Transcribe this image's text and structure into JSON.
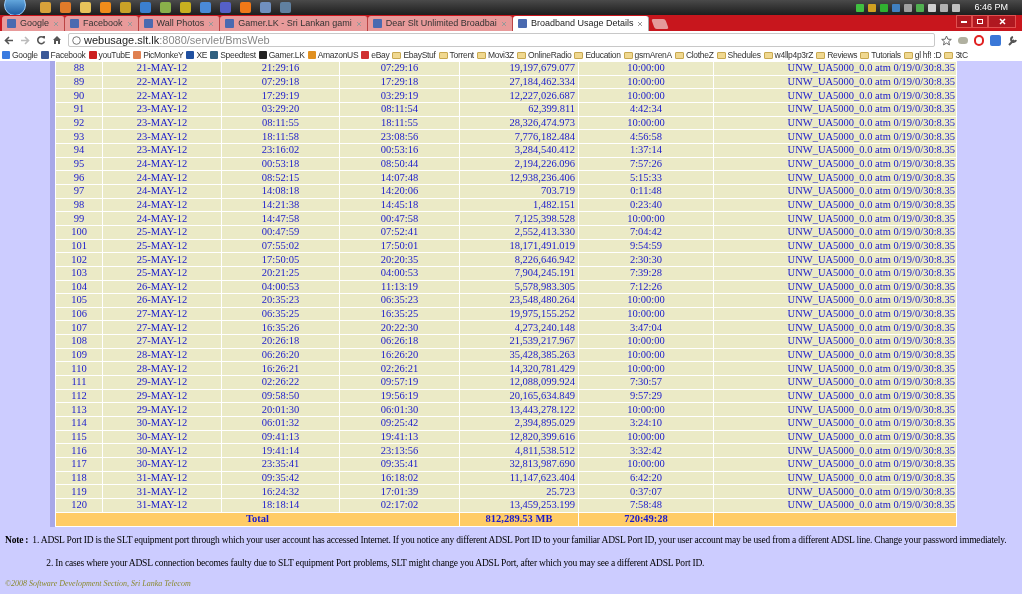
{
  "taskbar": {
    "apps": [
      {
        "color": "#d9a23a"
      },
      {
        "color": "#e07b2a"
      },
      {
        "color": "#e8c35a"
      },
      {
        "color": "#f08c1a"
      },
      {
        "color": "#c9a227"
      },
      {
        "color": "#3b7fd0"
      },
      {
        "color": "#8ab04a"
      },
      {
        "color": "#c8b020"
      },
      {
        "color": "#4a8ad8"
      },
      {
        "color": "#5560c8"
      },
      {
        "color": "#f07818"
      },
      {
        "color": "#7090c0"
      },
      {
        "color": "#6080a0"
      }
    ],
    "tray": [
      {
        "color": "#40c040"
      },
      {
        "color": "#d0a020"
      },
      {
        "color": "#30b030"
      },
      {
        "color": "#4080c0"
      },
      {
        "color": "#a0a0a0"
      },
      {
        "color": "#50b050"
      },
      {
        "color": "#d0d0d0"
      },
      {
        "color": "#b0b0b0"
      },
      {
        "color": "#c0c0c0"
      }
    ],
    "clock": "6:46 PM"
  },
  "tabs": [
    {
      "label": "Google",
      "selected": false
    },
    {
      "label": "Facebook",
      "selected": false
    },
    {
      "label": "Wall Photos",
      "selected": false
    },
    {
      "label": "Gamer.LK - Sri Lankan gami",
      "selected": false
    },
    {
      "label": "Dear Slt Unlimited Broadbai",
      "selected": false
    },
    {
      "label": "Broadband Usage Details",
      "selected": true
    }
  ],
  "address": {
    "host": "webusage.slt.lk",
    "path": ":8080/servlet/BmsWeb"
  },
  "bookmarks": [
    {
      "label": "Google",
      "kind": "site",
      "color": "#3a7be0"
    },
    {
      "label": "Facebook",
      "kind": "site",
      "color": "#3b5998"
    },
    {
      "label": "youTubE",
      "kind": "site",
      "color": "#cc2020"
    },
    {
      "label": "PicMonkeY",
      "kind": "site",
      "color": "#e08050"
    },
    {
      "label": "XE",
      "kind": "site",
      "color": "#2050a0"
    },
    {
      "label": "Speedtest",
      "kind": "site",
      "color": "#306080"
    },
    {
      "label": "Gamer.LK",
      "kind": "site",
      "color": "#222222"
    },
    {
      "label": "AmazonUS",
      "kind": "site",
      "color": "#e09020"
    },
    {
      "label": "eBay",
      "kind": "site",
      "color": "#d03030"
    },
    {
      "label": "EbayStuf",
      "kind": "folder"
    },
    {
      "label": "Torrent",
      "kind": "folder"
    },
    {
      "label": "Movi3Z",
      "kind": "folder"
    },
    {
      "label": "OnlineRadio",
      "kind": "folder"
    },
    {
      "label": "Education",
      "kind": "folder"
    },
    {
      "label": "gsmArenA",
      "kind": "folder"
    },
    {
      "label": "ClotheZ",
      "kind": "folder"
    },
    {
      "label": "Shedules",
      "kind": "folder"
    },
    {
      "label": "w4llp4p3rZ",
      "kind": "folder"
    },
    {
      "label": "Reviews",
      "kind": "folder"
    },
    {
      "label": "Tutorials",
      "kind": "folder"
    },
    {
      "label": "gl hf! :D",
      "kind": "folder"
    },
    {
      "label": "3tC",
      "kind": "folder"
    }
  ],
  "table": {
    "rows": [
      [
        "88",
        "21-MAY-12",
        "21:29:16",
        "07:29:16",
        "19,197,679.077",
        "10:00:00",
        "UNW_UA5000_0.0 atm 0/19/0/30:8.35"
      ],
      [
        "89",
        "22-MAY-12",
        "07:29:18",
        "17:29:18",
        "27,184,462.334",
        "10:00:00",
        "UNW_UA5000_0.0 atm 0/19/0/30:8.35"
      ],
      [
        "90",
        "22-MAY-12",
        "17:29:19",
        "03:29:19",
        "12,227,026.687",
        "10:00:00",
        "UNW_UA5000_0.0 atm 0/19/0/30:8.35"
      ],
      [
        "91",
        "23-MAY-12",
        "03:29:20",
        "08:11:54",
        "62,399.811",
        "4:42:34",
        "UNW_UA5000_0.0 atm 0/19/0/30:8.35"
      ],
      [
        "92",
        "23-MAY-12",
        "08:11:55",
        "18:11:55",
        "28,326,474.973",
        "10:00:00",
        "UNW_UA5000_0.0 atm 0/19/0/30:8.35"
      ],
      [
        "93",
        "23-MAY-12",
        "18:11:58",
        "23:08:56",
        "7,776,182.484",
        "4:56:58",
        "UNW_UA5000_0.0 atm 0/19/0/30:8.35"
      ],
      [
        "94",
        "23-MAY-12",
        "23:16:02",
        "00:53:16",
        "3,284,540.412",
        "1:37:14",
        "UNW_UA5000_0.0 atm 0/19/0/30:8.35"
      ],
      [
        "95",
        "24-MAY-12",
        "00:53:18",
        "08:50:44",
        "2,194,226.096",
        "7:57:26",
        "UNW_UA5000_0.0 atm 0/19/0/30:8.35"
      ],
      [
        "96",
        "24-MAY-12",
        "08:52:15",
        "14:07:48",
        "12,938,236.406",
        "5:15:33",
        "UNW_UA5000_0.0 atm 0/19/0/30:8.35"
      ],
      [
        "97",
        "24-MAY-12",
        "14:08:18",
        "14:20:06",
        "703.719",
        "0:11:48",
        "UNW_UA5000_0.0 atm 0/19/0/30:8.35"
      ],
      [
        "98",
        "24-MAY-12",
        "14:21:38",
        "14:45:18",
        "1,482.151",
        "0:23:40",
        "UNW_UA5000_0.0 atm 0/19/0/30:8.35"
      ],
      [
        "99",
        "24-MAY-12",
        "14:47:58",
        "00:47:58",
        "7,125,398.528",
        "10:00:00",
        "UNW_UA5000_0.0 atm 0/19/0/30:8.35"
      ],
      [
        "100",
        "25-MAY-12",
        "00:47:59",
        "07:52:41",
        "2,552,413.330",
        "7:04:42",
        "UNW_UA5000_0.0 atm 0/19/0/30:8.35"
      ],
      [
        "101",
        "25-MAY-12",
        "07:55:02",
        "17:50:01",
        "18,171,491.019",
        "9:54:59",
        "UNW_UA5000_0.0 atm 0/19/0/30:8.35"
      ],
      [
        "102",
        "25-MAY-12",
        "17:50:05",
        "20:20:35",
        "8,226,646.942",
        "2:30:30",
        "UNW_UA5000_0.0 atm 0/19/0/30:8.35"
      ],
      [
        "103",
        "25-MAY-12",
        "20:21:25",
        "04:00:53",
        "7,904,245.191",
        "7:39:28",
        "UNW_UA5000_0.0 atm 0/19/0/30:8.35"
      ],
      [
        "104",
        "26-MAY-12",
        "04:00:53",
        "11:13:19",
        "5,578,983.305",
        "7:12:26",
        "UNW_UA5000_0.0 atm 0/19/0/30:8.35"
      ],
      [
        "105",
        "26-MAY-12",
        "20:35:23",
        "06:35:23",
        "23,548,480.264",
        "10:00:00",
        "UNW_UA5000_0.0 atm 0/19/0/30:8.35"
      ],
      [
        "106",
        "27-MAY-12",
        "06:35:25",
        "16:35:25",
        "19,975,155.252",
        "10:00:00",
        "UNW_UA5000_0.0 atm 0/19/0/30:8.35"
      ],
      [
        "107",
        "27-MAY-12",
        "16:35:26",
        "20:22:30",
        "4,273,240.148",
        "3:47:04",
        "UNW_UA5000_0.0 atm 0/19/0/30:8.35"
      ],
      [
        "108",
        "27-MAY-12",
        "20:26:18",
        "06:26:18",
        "21,539,217.967",
        "10:00:00",
        "UNW_UA5000_0.0 atm 0/19/0/30:8.35"
      ],
      [
        "109",
        "28-MAY-12",
        "06:26:20",
        "16:26:20",
        "35,428,385.263",
        "10:00:00",
        "UNW_UA5000_0.0 atm 0/19/0/30:8.35"
      ],
      [
        "110",
        "28-MAY-12",
        "16:26:21",
        "02:26:21",
        "14,320,781.429",
        "10:00:00",
        "UNW_UA5000_0.0 atm 0/19/0/30:8.35"
      ],
      [
        "111",
        "29-MAY-12",
        "02:26:22",
        "09:57:19",
        "12,088,099.924",
        "7:30:57",
        "UNW_UA5000_0.0 atm 0/19/0/30:8.35"
      ],
      [
        "112",
        "29-MAY-12",
        "09:58:50",
        "19:56:19",
        "20,165,634.849",
        "9:57:29",
        "UNW_UA5000_0.0 atm 0/19/0/30:8.35"
      ],
      [
        "113",
        "29-MAY-12",
        "20:01:30",
        "06:01:30",
        "13,443,278.122",
        "10:00:00",
        "UNW_UA5000_0.0 atm 0/19/0/30:8.35"
      ],
      [
        "114",
        "30-MAY-12",
        "06:01:32",
        "09:25:42",
        "2,394,895.029",
        "3:24:10",
        "UNW_UA5000_0.0 atm 0/19/0/30:8.35"
      ],
      [
        "115",
        "30-MAY-12",
        "09:41:13",
        "19:41:13",
        "12,820,399.616",
        "10:00:00",
        "UNW_UA5000_0.0 atm 0/19/0/30:8.35"
      ],
      [
        "116",
        "30-MAY-12",
        "19:41:14",
        "23:13:56",
        "4,811,538.512",
        "3:32:42",
        "UNW_UA5000_0.0 atm 0/19/0/30:8.35"
      ],
      [
        "117",
        "30-MAY-12",
        "23:35:41",
        "09:35:41",
        "32,813,987.690",
        "10:00:00",
        "UNW_UA5000_0.0 atm 0/19/0/30:8.35"
      ],
      [
        "118",
        "31-MAY-12",
        "09:35:42",
        "16:18:02",
        "11,147,623.404",
        "6:42:20",
        "UNW_UA5000_0.0 atm 0/19/0/30:8.35"
      ],
      [
        "119",
        "31-MAY-12",
        "16:24:32",
        "17:01:39",
        "25.723",
        "0:37:07",
        "UNW_UA5000_0.0 atm 0/19/0/30:8.35"
      ],
      [
        "120",
        "31-MAY-12",
        "18:18:14",
        "02:17:02",
        "13,459,253.199",
        "7:58:48",
        "UNW_UA5000_0.0 atm 0/19/0/30:8.35"
      ]
    ],
    "total": {
      "label": "Total",
      "bytes": "812,289.53 MB",
      "duration": "720:49:28"
    }
  },
  "note": {
    "label": "Note :",
    "items": [
      "1. ADSL Port ID is the SLT equipment port through which your user account has accessed Internet. If you notice any different ADSL Port ID to your familiar ADSL Port ID, your user account may be used from a different ADSL line. Change your password immediately.",
      "2. In cases where your ADSL connection becomes faulty due to SLT equipment Port problems, SLT might change you ADSL Port, after which you may see a different ADSL Port ID."
    ]
  },
  "copyright": "©2008 Software Development Section, Sri Lanka Telecom"
}
